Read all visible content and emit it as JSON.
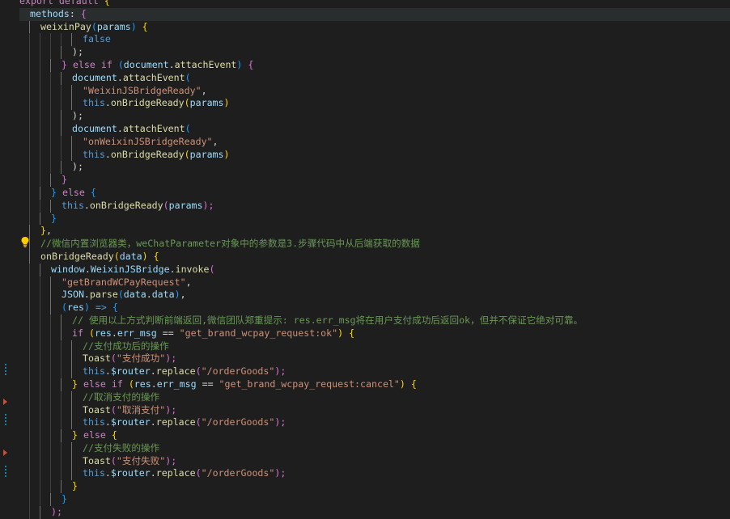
{
  "editor": {
    "theme_colors": {
      "background": "#1e1e1e",
      "keyword": "#c586c0",
      "storage": "#569cd6",
      "function": "#dcdcaa",
      "variable": "#9cdcfe",
      "string": "#ce9178",
      "comment": "#6a9955"
    },
    "lines": [
      {
        "t": [
          [
            "export default ",
            "k"
          ],
          [
            "{",
            "b1"
          ]
        ],
        "i": 0
      },
      {
        "t": [
          [
            "methods",
            "v"
          ],
          [
            ": ",
            "p"
          ],
          [
            "{",
            "b2"
          ]
        ],
        "i": 1,
        "hl": true
      },
      {
        "t": [
          [
            "weixinPay",
            "fn"
          ],
          [
            "(",
            "b3"
          ],
          [
            "params",
            "v"
          ],
          [
            ") ",
            "b3"
          ],
          [
            "{",
            "b1"
          ]
        ],
        "i": 2
      },
      {
        "t": [
          [
            "false",
            "kw"
          ]
        ],
        "i": 6
      },
      {
        "t": [
          [
            ");",
            "p"
          ]
        ],
        "i": 5
      },
      {
        "t": [
          [
            "} ",
            "b2"
          ],
          [
            "else if ",
            "k"
          ],
          [
            "(",
            "b3"
          ],
          [
            "document",
            "v"
          ],
          [
            ".",
            "p"
          ],
          [
            "attachEvent",
            "fn"
          ],
          [
            ") ",
            "b3"
          ],
          [
            "{",
            "b2"
          ]
        ],
        "i": 4
      },
      {
        "t": [
          [
            "document",
            "v"
          ],
          [
            ".",
            "p"
          ],
          [
            "attachEvent",
            "fn"
          ],
          [
            "(",
            "b3"
          ]
        ],
        "i": 5
      },
      {
        "t": [
          [
            "\"WeixinJSBridgeReady\"",
            "s"
          ],
          [
            ",",
            "p"
          ]
        ],
        "i": 6
      },
      {
        "t": [
          [
            "this",
            "kw"
          ],
          [
            ".",
            "p"
          ],
          [
            "onBridgeReady",
            "fn"
          ],
          [
            "(",
            "b1"
          ],
          [
            "params",
            "v"
          ],
          [
            ")",
            "b1"
          ]
        ],
        "i": 6
      },
      {
        "t": [
          [
            ");",
            "p"
          ]
        ],
        "i": 5
      },
      {
        "t": [
          [
            "document",
            "v"
          ],
          [
            ".",
            "p"
          ],
          [
            "attachEvent",
            "fn"
          ],
          [
            "(",
            "b3"
          ]
        ],
        "i": 5
      },
      {
        "t": [
          [
            "\"onWeixinJSBridgeReady\"",
            "s"
          ],
          [
            ",",
            "p"
          ]
        ],
        "i": 6
      },
      {
        "t": [
          [
            "this",
            "kw"
          ],
          [
            ".",
            "p"
          ],
          [
            "onBridgeReady",
            "fn"
          ],
          [
            "(",
            "b1"
          ],
          [
            "params",
            "v"
          ],
          [
            ")",
            "b1"
          ]
        ],
        "i": 6
      },
      {
        "t": [
          [
            ");",
            "p"
          ]
        ],
        "i": 5
      },
      {
        "t": [
          [
            "}",
            "b2"
          ]
        ],
        "i": 4
      },
      {
        "t": [
          [
            "} ",
            "b3"
          ],
          [
            "else ",
            "k"
          ],
          [
            "{",
            "b3"
          ]
        ],
        "i": 3
      },
      {
        "t": [
          [
            "this",
            "kw"
          ],
          [
            ".",
            "p"
          ],
          [
            "onBridgeReady",
            "fn"
          ],
          [
            "(",
            "b2"
          ],
          [
            "params",
            "v"
          ],
          [
            ");",
            "b2"
          ]
        ],
        "i": 4
      },
      {
        "t": [
          [
            "}",
            "b3"
          ]
        ],
        "i": 3
      },
      {
        "t": [
          [
            "}",
            "b1"
          ],
          [
            ",",
            "p"
          ]
        ],
        "i": 2
      },
      {
        "t": [
          [
            "//微信内置浏览器类，weChatParameter对象中的参数是3.步骤代码中从后端获取的数据",
            "c"
          ]
        ],
        "i": 2
      },
      {
        "t": [
          [
            "onBridgeReady",
            "fn"
          ],
          [
            "(",
            "b1"
          ],
          [
            "data",
            "v"
          ],
          [
            ") ",
            "b1"
          ],
          [
            "{",
            "b1"
          ]
        ],
        "i": 2
      },
      {
        "t": [
          [
            "window",
            "v"
          ],
          [
            ".",
            "p"
          ],
          [
            "WeixinJSBridge",
            "v"
          ],
          [
            ".",
            "p"
          ],
          [
            "invoke",
            "fn"
          ],
          [
            "(",
            "b2"
          ]
        ],
        "i": 3
      },
      {
        "t": [
          [
            "\"getBrandWCPayRequest\"",
            "s"
          ],
          [
            ",",
            "p"
          ]
        ],
        "i": 4
      },
      {
        "t": [
          [
            "JSON",
            "v"
          ],
          [
            ".",
            "p"
          ],
          [
            "parse",
            "fn"
          ],
          [
            "(",
            "b3"
          ],
          [
            "data",
            "v"
          ],
          [
            ".",
            "p"
          ],
          [
            "data",
            "v"
          ],
          [
            ")",
            "b3"
          ],
          [
            ",",
            "p"
          ]
        ],
        "i": 4
      },
      {
        "t": [
          [
            "(",
            "b3"
          ],
          [
            "res",
            "v"
          ],
          [
            ") ",
            "b3"
          ],
          [
            "=> ",
            "kw"
          ],
          [
            "{",
            "b3"
          ]
        ],
        "i": 4
      },
      {
        "t": [
          [
            "// 使用以上方式判断前端返回,微信团队郑重提示: res.err_msg将在用户支付成功后返回ok，但并不保证它绝对可靠。",
            "c"
          ]
        ],
        "i": 5
      },
      {
        "t": [
          [
            "if ",
            "k"
          ],
          [
            "(",
            "b1"
          ],
          [
            "res",
            "v"
          ],
          [
            ".",
            "p"
          ],
          [
            "err_msg",
            "v"
          ],
          [
            " == ",
            "p"
          ],
          [
            "\"get_brand_wcpay_request:ok\"",
            "s"
          ],
          [
            ") ",
            "b1"
          ],
          [
            "{",
            "b1"
          ]
        ],
        "i": 5
      },
      {
        "t": [
          [
            "//支付成功后的操作",
            "c"
          ]
        ],
        "i": 6
      },
      {
        "t": [
          [
            "Toast",
            "fn"
          ],
          [
            "(",
            "b2"
          ],
          [
            "\"支付成功\"",
            "s"
          ],
          [
            ");",
            "b2"
          ]
        ],
        "i": 6
      },
      {
        "t": [
          [
            "this",
            "kw"
          ],
          [
            ".",
            "p"
          ],
          [
            "$router",
            "v"
          ],
          [
            ".",
            "p"
          ],
          [
            "replace",
            "fn"
          ],
          [
            "(",
            "b2"
          ],
          [
            "\"/orderGoods\"",
            "s"
          ],
          [
            ");",
            "b2"
          ]
        ],
        "i": 6
      },
      {
        "t": [
          [
            "} ",
            "b1"
          ],
          [
            "else if ",
            "k"
          ],
          [
            "(",
            "b1"
          ],
          [
            "res",
            "v"
          ],
          [
            ".",
            "p"
          ],
          [
            "err_msg",
            "v"
          ],
          [
            " == ",
            "p"
          ],
          [
            "\"get_brand_wcpay_request:cancel\"",
            "s"
          ],
          [
            ") ",
            "b1"
          ],
          [
            "{",
            "b1"
          ]
        ],
        "i": 5
      },
      {
        "t": [
          [
            "//取消支付的操作",
            "c"
          ]
        ],
        "i": 6
      },
      {
        "t": [
          [
            "Toast",
            "fn"
          ],
          [
            "(",
            "b2"
          ],
          [
            "\"取消支付\"",
            "s"
          ],
          [
            ");",
            "b2"
          ]
        ],
        "i": 6
      },
      {
        "t": [
          [
            "this",
            "kw"
          ],
          [
            ".",
            "p"
          ],
          [
            "$router",
            "v"
          ],
          [
            ".",
            "p"
          ],
          [
            "replace",
            "fn"
          ],
          [
            "(",
            "b2"
          ],
          [
            "\"/orderGoods\"",
            "s"
          ],
          [
            ");",
            "b2"
          ]
        ],
        "i": 6
      },
      {
        "t": [
          [
            "} ",
            "b1"
          ],
          [
            "else ",
            "k"
          ],
          [
            "{",
            "b1"
          ]
        ],
        "i": 5
      },
      {
        "t": [
          [
            "//支付失败的操作",
            "c"
          ]
        ],
        "i": 6
      },
      {
        "t": [
          [
            "Toast",
            "fn"
          ],
          [
            "(",
            "b2"
          ],
          [
            "\"支付失败\"",
            "s"
          ],
          [
            ");",
            "b2"
          ]
        ],
        "i": 6
      },
      {
        "t": [
          [
            "this",
            "kw"
          ],
          [
            ".",
            "p"
          ],
          [
            "$router",
            "v"
          ],
          [
            ".",
            "p"
          ],
          [
            "replace",
            "fn"
          ],
          [
            "(",
            "b2"
          ],
          [
            "\"/orderGoods\"",
            "s"
          ],
          [
            ");",
            "b2"
          ]
        ],
        "i": 6
      },
      {
        "t": [
          [
            "}",
            "b1"
          ]
        ],
        "i": 5
      },
      {
        "t": [
          [
            "}",
            "b3"
          ]
        ],
        "i": 4
      },
      {
        "t": [
          [
            ");",
            "b2"
          ]
        ],
        "i": 3
      }
    ]
  }
}
